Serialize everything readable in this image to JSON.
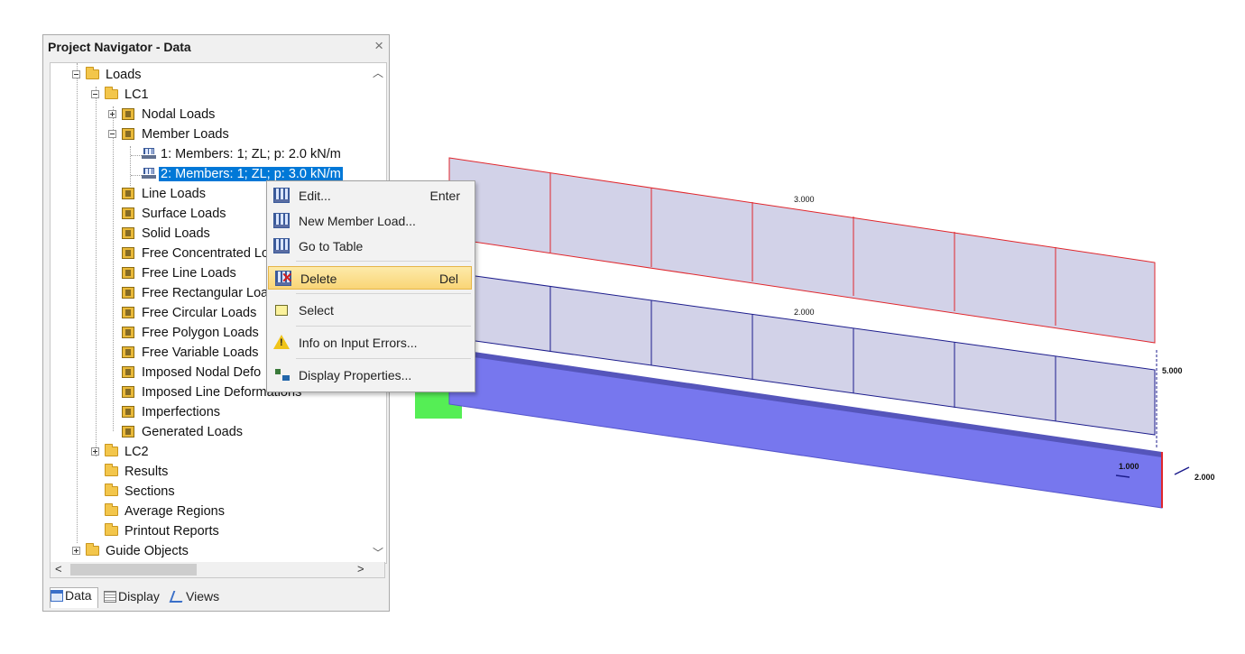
{
  "navigator": {
    "title": "Project Navigator - Data",
    "close_label": "×",
    "tree": [
      {
        "label": "Loads",
        "icon": "folder-icon"
      },
      {
        "label": "LC1",
        "icon": "folder-icon"
      },
      {
        "label": "Nodal Loads",
        "icon": "nodal-loads-icon"
      },
      {
        "label": "Member Loads",
        "icon": "member-loads-icon"
      },
      {
        "label": "1: Members: 1; ZL; p: 2.0 kN/m",
        "icon": "member-load-icon"
      },
      {
        "label": "2: Members: 1; ZL; p: 3.0 kN/m",
        "icon": "member-load-icon",
        "selected": true
      },
      {
        "label": "Line Loads",
        "icon": "line-loads-icon"
      },
      {
        "label": "Surface Loads",
        "icon": "surface-loads-icon"
      },
      {
        "label": "Solid Loads",
        "icon": "solid-loads-icon"
      },
      {
        "label": "Free Concentrated Lo",
        "icon": "free-concentrated-loads-icon"
      },
      {
        "label": "Free Line Loads",
        "icon": "free-line-loads-icon"
      },
      {
        "label": "Free Rectangular Loa",
        "icon": "free-rectangular-loads-icon"
      },
      {
        "label": "Free Circular Loads",
        "icon": "free-circular-loads-icon"
      },
      {
        "label": "Free Polygon Loads",
        "icon": "free-polygon-loads-icon"
      },
      {
        "label": "Free Variable Loads",
        "icon": "free-variable-loads-icon"
      },
      {
        "label": "Imposed Nodal Defo",
        "icon": "imposed-nodal-deformations-icon"
      },
      {
        "label": "Imposed Line Deformations",
        "icon": "imposed-line-deformations-icon"
      },
      {
        "label": "Imperfections",
        "icon": "imperfections-icon"
      },
      {
        "label": "Generated Loads",
        "icon": "generated-loads-icon"
      },
      {
        "label": "LC2",
        "icon": "folder-icon"
      },
      {
        "label": "Results",
        "icon": "folder-icon"
      },
      {
        "label": "Sections",
        "icon": "folder-icon"
      },
      {
        "label": "Average Regions",
        "icon": "folder-icon"
      },
      {
        "label": "Printout Reports",
        "icon": "folder-icon"
      },
      {
        "label": "Guide Objects",
        "icon": "folder-icon"
      }
    ],
    "tabs": [
      {
        "label": "Data",
        "icon": "data-tab-icon"
      },
      {
        "label": "Display",
        "icon": "display-tab-icon"
      },
      {
        "label": "Views",
        "icon": "views-tab-icon"
      }
    ]
  },
  "context_menu": {
    "items": [
      {
        "label": "Edit...",
        "shortcut": "Enter",
        "icon": "edit-load-icon"
      },
      {
        "label": "New Member Load...",
        "shortcut": "",
        "icon": "new-member-load-icon"
      },
      {
        "label": "Go to Table",
        "shortcut": "",
        "icon": "table-icon"
      },
      {
        "label": "Delete",
        "shortcut": "Del",
        "icon": "delete-icon"
      },
      {
        "label": "Select",
        "shortcut": "",
        "icon": "select-icon"
      },
      {
        "label": "Info on Input Errors...",
        "shortcut": "",
        "icon": "warning-icon"
      },
      {
        "label": "Display Properties...",
        "shortcut": "",
        "icon": "display-properties-icon"
      }
    ]
  },
  "model_view": {
    "load_labels": {
      "upper": "3.000",
      "lower": "2.000"
    },
    "dimension_labels": {
      "vertical": "5.000",
      "axial": "1.000",
      "lateral": "2.000"
    },
    "colors": {
      "upper_load": "#e0262c",
      "lower_load": "#1c1c8c",
      "load_fill": "#d2d2e8",
      "beam": "#7777ee",
      "support": "#55ee55"
    }
  }
}
